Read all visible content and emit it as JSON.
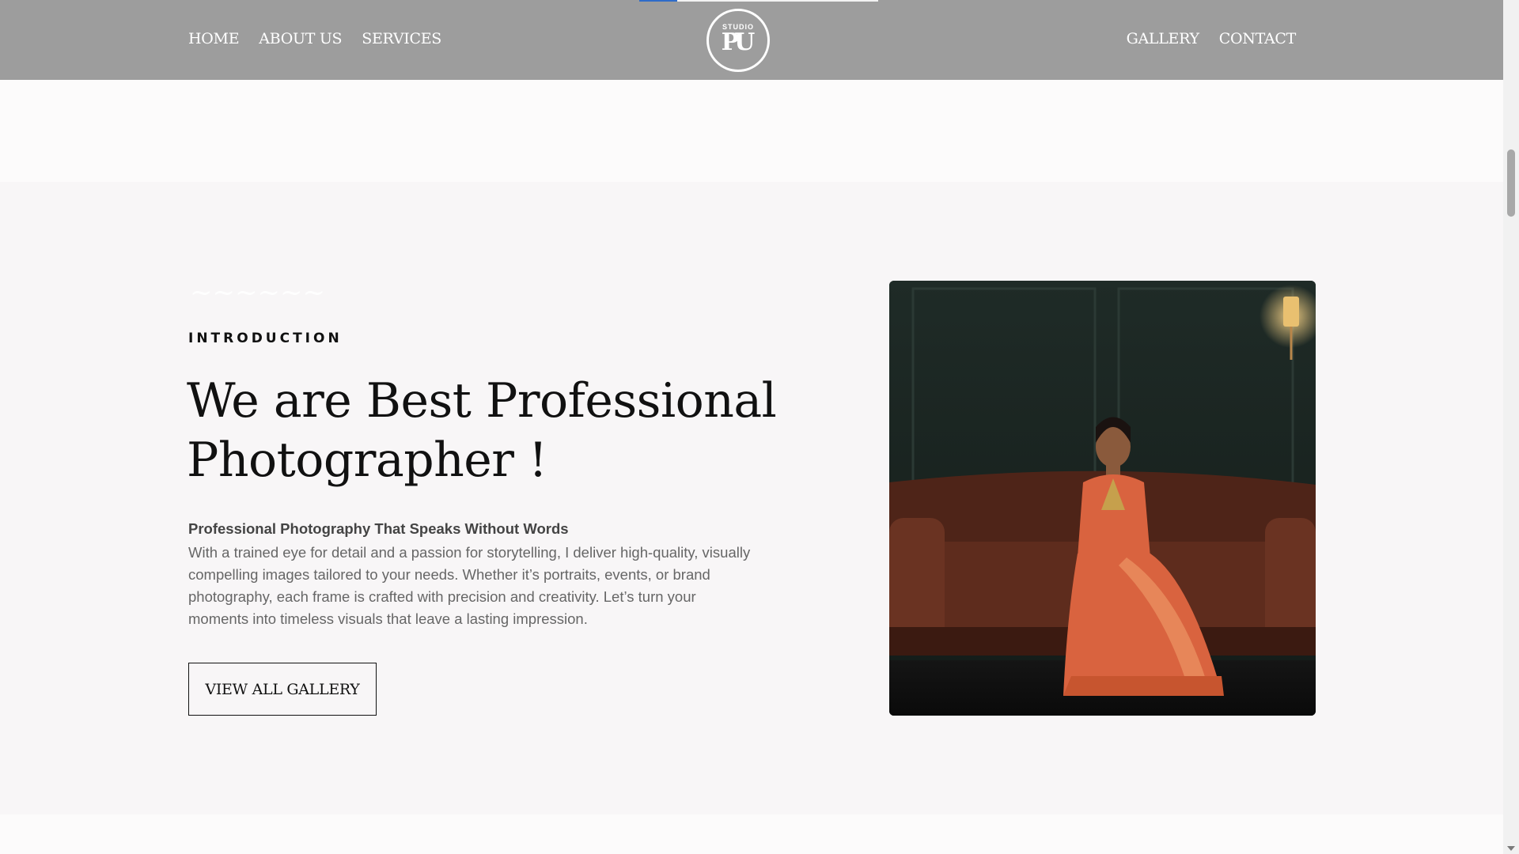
{
  "header": {
    "nav_left": [
      "HOME",
      "ABOUT US",
      "SERVICES"
    ],
    "nav_right": [
      "GALLERY",
      "CONTACT"
    ],
    "logo": {
      "small_text": "STUDIO",
      "mark": "PU"
    },
    "scroll_progress": 0.16
  },
  "intro": {
    "eyebrow": "INTRODUCTION",
    "headline_line1": "We are Best Professional",
    "headline_line2": "Photographer !",
    "subhead": "Professional Photography That Speaks Without Words",
    "body": "With a trained eye for detail and a passion for storytelling, I deliver high-quality, visually compelling images tailored to your needs. Whether it’s portraits, events, or brand photography, each frame is crafted with precision and creativity. Let’s turn your moments into timeless visuals that leave a lasting impression.",
    "cta_label": "VIEW ALL GALLERY"
  },
  "colors": {
    "header_bg": "#9d9d9d",
    "progress_fill": "#2f6cc9",
    "section_bg": "#f8f6f7",
    "saree": "#d9633f",
    "sofa": "#5a2a1c"
  },
  "icons": [
    "studio-logo-icon",
    "chevron-down-icon"
  ]
}
